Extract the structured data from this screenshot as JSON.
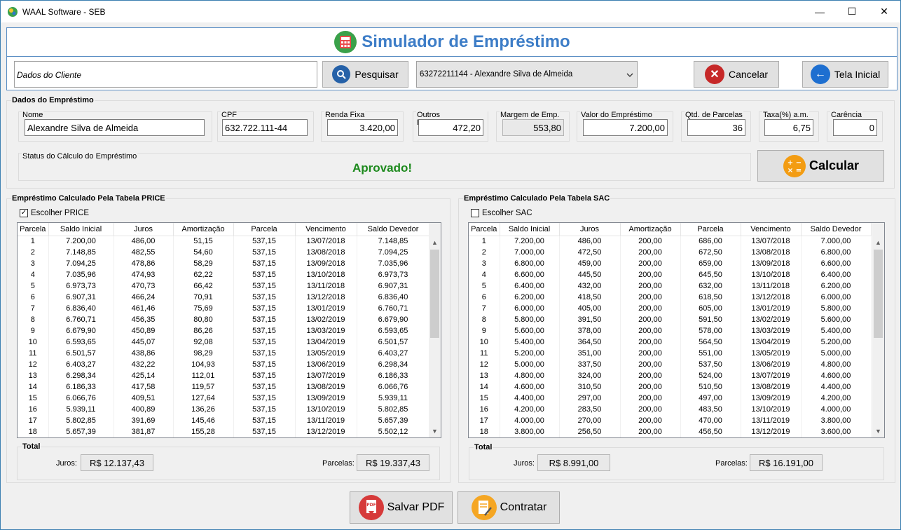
{
  "window": {
    "title": "WAAL Software - SEB",
    "minimize": "—",
    "maximize": "☐",
    "close": "✕"
  },
  "header": {
    "title": "Simulador de Empréstimo"
  },
  "toolbar": {
    "client_label": "Dados do Cliente",
    "search_label": "Pesquisar",
    "client_select": "63272211144 - Alexandre Silva de Almeida",
    "cancel_label": "Cancelar",
    "home_label": "Tela Inicial"
  },
  "loan": {
    "group_title": "Dados do Empréstimo",
    "nome_label": "Nome",
    "nome": "Alexandre Silva de Almeida",
    "cpf_label": "CPF",
    "cpf": "632.722.111-44",
    "renda_label": "Renda Fixa",
    "renda": "3.420,00",
    "outros_label": "Outros Empréstimos",
    "outros": "472,20",
    "margem_label": "Margem de Emp.",
    "margem": "553,80",
    "valor_label": "Valor do Empréstimo",
    "valor": "7.200,00",
    "parcelas_label": "Qtd. de Parcelas",
    "parcelas": "36",
    "taxa_label": "Taxa(%) a.m.",
    "taxa": "6,75",
    "carencia_label": "Carência",
    "carencia": "0",
    "status_label": "Status do Cálculo do Empréstimo",
    "status": "Aprovado!",
    "calc_label": "Calcular"
  },
  "columns": [
    "Parcela",
    "Saldo Inicial",
    "Juros",
    "Amortização",
    "Parcela",
    "Vencimento",
    "Saldo Devedor"
  ],
  "price": {
    "title": "Empréstimo Calculado Pela Tabela PRICE",
    "checkbox": "Escolher PRICE",
    "checked": true,
    "total_title": "Total",
    "juros_label": "Juros:",
    "juros_total": "R$ 12.137,43",
    "parcelas_label": "Parcelas:",
    "parcelas_total": "R$ 19.337,43",
    "rows": [
      [
        "1",
        "7.200,00",
        "486,00",
        "51,15",
        "537,15",
        "13/07/2018",
        "7.148,85"
      ],
      [
        "2",
        "7.148,85",
        "482,55",
        "54,60",
        "537,15",
        "13/08/2018",
        "7.094,25"
      ],
      [
        "3",
        "7.094,25",
        "478,86",
        "58,29",
        "537,15",
        "13/09/2018",
        "7.035,96"
      ],
      [
        "4",
        "7.035,96",
        "474,93",
        "62,22",
        "537,15",
        "13/10/2018",
        "6.973,73"
      ],
      [
        "5",
        "6.973,73",
        "470,73",
        "66,42",
        "537,15",
        "13/11/2018",
        "6.907,31"
      ],
      [
        "6",
        "6.907,31",
        "466,24",
        "70,91",
        "537,15",
        "13/12/2018",
        "6.836,40"
      ],
      [
        "7",
        "6.836,40",
        "461,46",
        "75,69",
        "537,15",
        "13/01/2019",
        "6.760,71"
      ],
      [
        "8",
        "6.760,71",
        "456,35",
        "80,80",
        "537,15",
        "13/02/2019",
        "6.679,90"
      ],
      [
        "9",
        "6.679,90",
        "450,89",
        "86,26",
        "537,15",
        "13/03/2019",
        "6.593,65"
      ],
      [
        "10",
        "6.593,65",
        "445,07",
        "92,08",
        "537,15",
        "13/04/2019",
        "6.501,57"
      ],
      [
        "11",
        "6.501,57",
        "438,86",
        "98,29",
        "537,15",
        "13/05/2019",
        "6.403,27"
      ],
      [
        "12",
        "6.403,27",
        "432,22",
        "104,93",
        "537,15",
        "13/06/2019",
        "6.298,34"
      ],
      [
        "13",
        "6.298,34",
        "425,14",
        "112,01",
        "537,15",
        "13/07/2019",
        "6.186,33"
      ],
      [
        "14",
        "6.186,33",
        "417,58",
        "119,57",
        "537,15",
        "13/08/2019",
        "6.066,76"
      ],
      [
        "15",
        "6.066,76",
        "409,51",
        "127,64",
        "537,15",
        "13/09/2019",
        "5.939,11"
      ],
      [
        "16",
        "5.939,11",
        "400,89",
        "136,26",
        "537,15",
        "13/10/2019",
        "5.802,85"
      ],
      [
        "17",
        "5.802,85",
        "391,69",
        "145,46",
        "537,15",
        "13/11/2019",
        "5.657,39"
      ],
      [
        "18",
        "5.657,39",
        "381,87",
        "155,28",
        "537,15",
        "13/12/2019",
        "5.502,12"
      ]
    ]
  },
  "sac": {
    "title": "Empréstimo Calculado Pela Tabela SAC",
    "checkbox": "Escolher SAC",
    "checked": false,
    "total_title": "Total",
    "juros_label": "Juros:",
    "juros_total": "R$ 8.991,00",
    "parcelas_label": "Parcelas:",
    "parcelas_total": "R$ 16.191,00",
    "rows": [
      [
        "1",
        "7.200,00",
        "486,00",
        "200,00",
        "686,00",
        "13/07/2018",
        "7.000,00"
      ],
      [
        "2",
        "7.000,00",
        "472,50",
        "200,00",
        "672,50",
        "13/08/2018",
        "6.800,00"
      ],
      [
        "3",
        "6.800,00",
        "459,00",
        "200,00",
        "659,00",
        "13/09/2018",
        "6.600,00"
      ],
      [
        "4",
        "6.600,00",
        "445,50",
        "200,00",
        "645,50",
        "13/10/2018",
        "6.400,00"
      ],
      [
        "5",
        "6.400,00",
        "432,00",
        "200,00",
        "632,00",
        "13/11/2018",
        "6.200,00"
      ],
      [
        "6",
        "6.200,00",
        "418,50",
        "200,00",
        "618,50",
        "13/12/2018",
        "6.000,00"
      ],
      [
        "7",
        "6.000,00",
        "405,00",
        "200,00",
        "605,00",
        "13/01/2019",
        "5.800,00"
      ],
      [
        "8",
        "5.800,00",
        "391,50",
        "200,00",
        "591,50",
        "13/02/2019",
        "5.600,00"
      ],
      [
        "9",
        "5.600,00",
        "378,00",
        "200,00",
        "578,00",
        "13/03/2019",
        "5.400,00"
      ],
      [
        "10",
        "5.400,00",
        "364,50",
        "200,00",
        "564,50",
        "13/04/2019",
        "5.200,00"
      ],
      [
        "11",
        "5.200,00",
        "351,00",
        "200,00",
        "551,00",
        "13/05/2019",
        "5.000,00"
      ],
      [
        "12",
        "5.000,00",
        "337,50",
        "200,00",
        "537,50",
        "13/06/2019",
        "4.800,00"
      ],
      [
        "13",
        "4.800,00",
        "324,00",
        "200,00",
        "524,00",
        "13/07/2019",
        "4.600,00"
      ],
      [
        "14",
        "4.600,00",
        "310,50",
        "200,00",
        "510,50",
        "13/08/2019",
        "4.400,00"
      ],
      [
        "15",
        "4.400,00",
        "297,00",
        "200,00",
        "497,00",
        "13/09/2019",
        "4.200,00"
      ],
      [
        "16",
        "4.200,00",
        "283,50",
        "200,00",
        "483,50",
        "13/10/2019",
        "4.000,00"
      ],
      [
        "17",
        "4.000,00",
        "270,00",
        "200,00",
        "470,00",
        "13/11/2019",
        "3.800,00"
      ],
      [
        "18",
        "3.800,00",
        "256,50",
        "200,00",
        "456,50",
        "13/12/2019",
        "3.600,00"
      ]
    ]
  },
  "footer": {
    "pdf_label": "Salvar PDF",
    "contract_label": "Contratar",
    "pdf_icon_text": "PDF"
  }
}
